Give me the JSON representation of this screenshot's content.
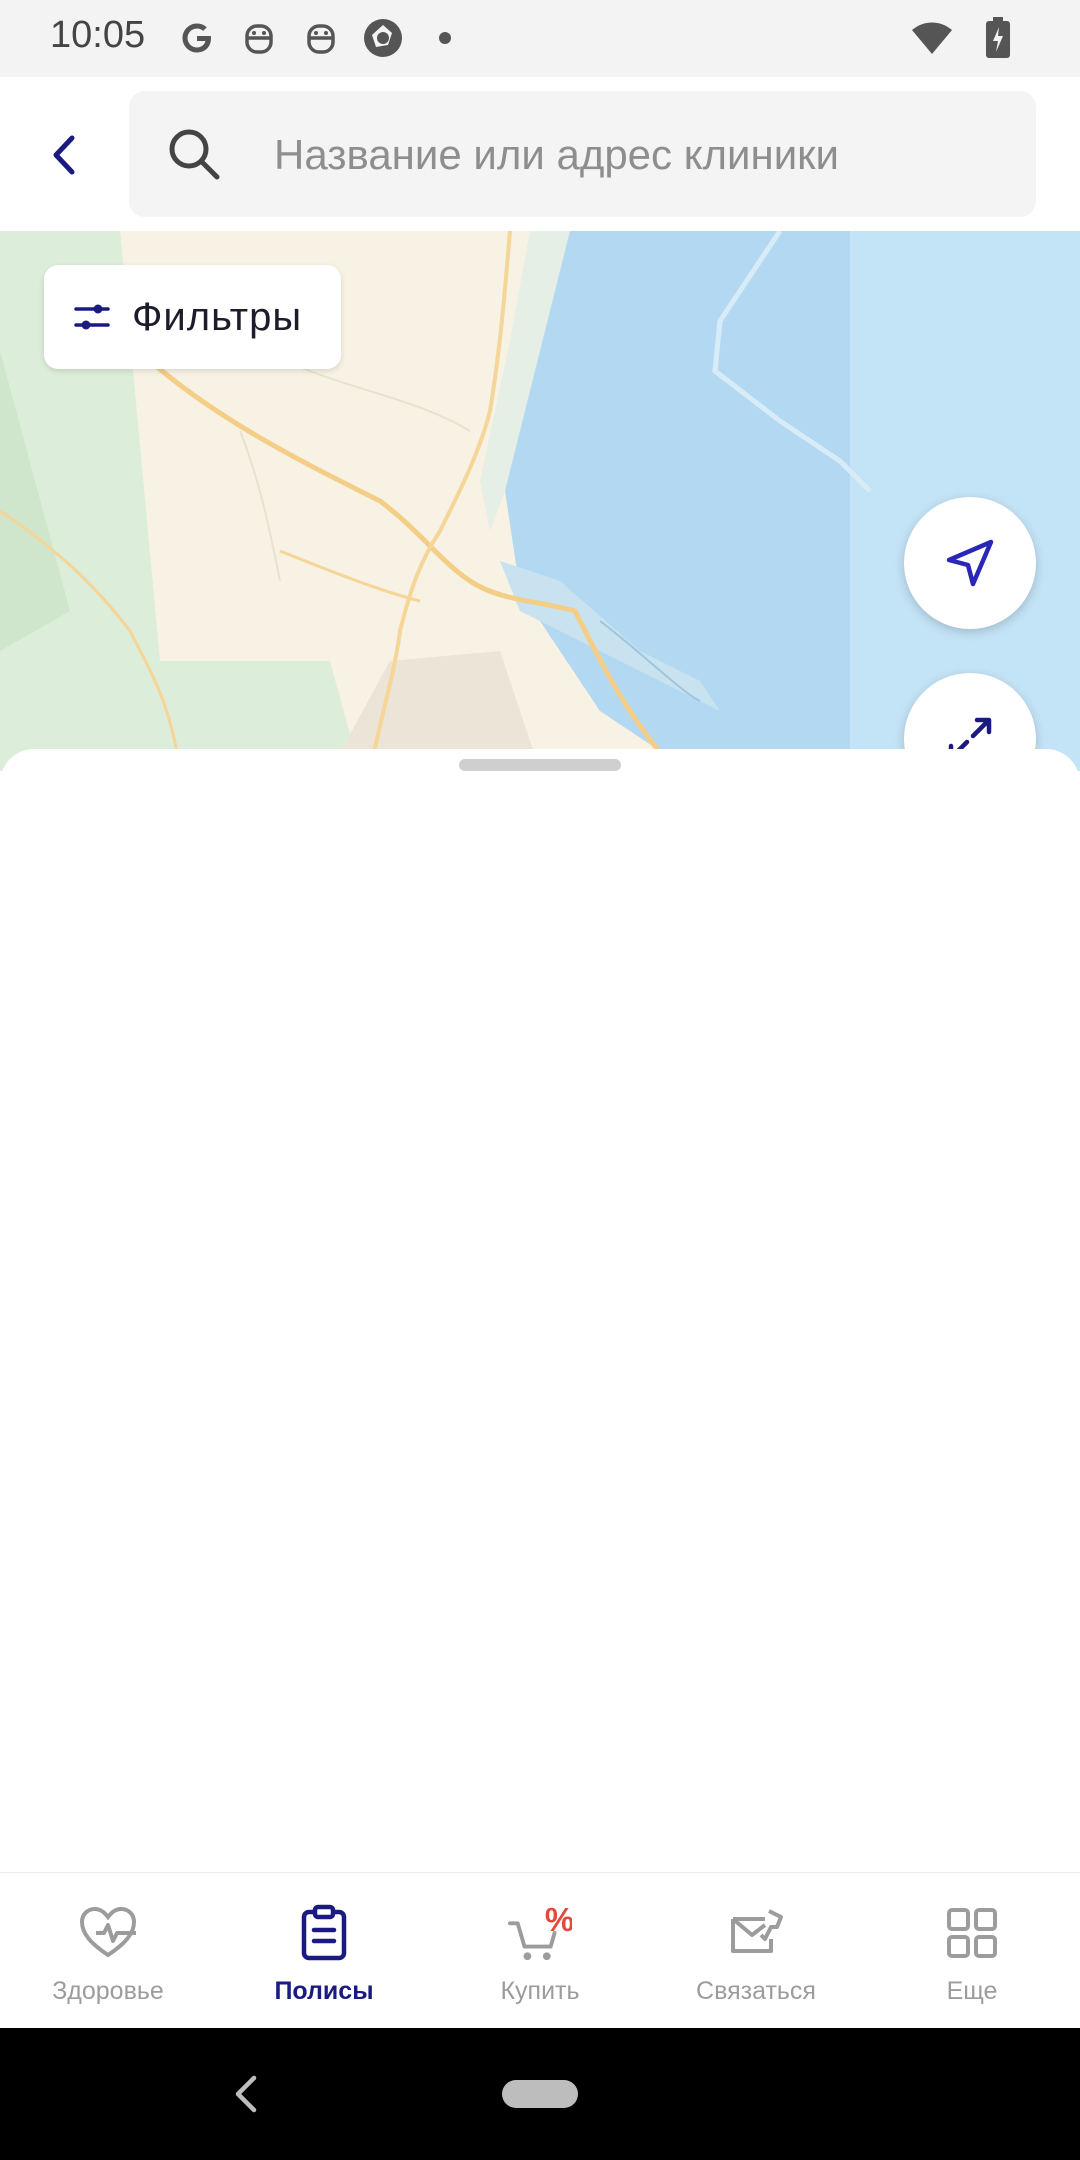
{
  "status_bar": {
    "time": "10:05",
    "icons_left": [
      "google-icon",
      "robot-icon",
      "robot-icon",
      "camera-shutter-icon",
      "dot-icon"
    ],
    "icons_right": [
      "wifi-icon",
      "battery-charging-icon"
    ]
  },
  "header": {
    "back_icon": "chevron-left-icon",
    "search": {
      "placeholder": "Название или адрес клиники",
      "value": ""
    }
  },
  "map": {
    "filters_label": "Фильтры",
    "locate_button_icon": "navigation-arrow-icon",
    "expand_button_icon": "expand-arrows-icon",
    "colors": {
      "water": "#b3d9f2",
      "land": "#f7f2e3",
      "park": "#d9ecd8",
      "road": "#f3c77c"
    }
  },
  "bottom_nav": {
    "items": [
      {
        "label": "Здоровье",
        "icon": "heart-pulse-icon",
        "active": false
      },
      {
        "label": "Полисы",
        "icon": "clipboard-icon",
        "active": true
      },
      {
        "label": "Купить",
        "icon": "cart-discount-icon",
        "active": false
      },
      {
        "label": "Связаться",
        "icon": "envelope-phone-icon",
        "active": false
      },
      {
        "label": "Еще",
        "icon": "grid-icon",
        "active": false
      }
    ]
  },
  "theme": {
    "accent": "#1a1a80",
    "inactive": "#9c9c9c",
    "discount": "#e14b3b"
  }
}
